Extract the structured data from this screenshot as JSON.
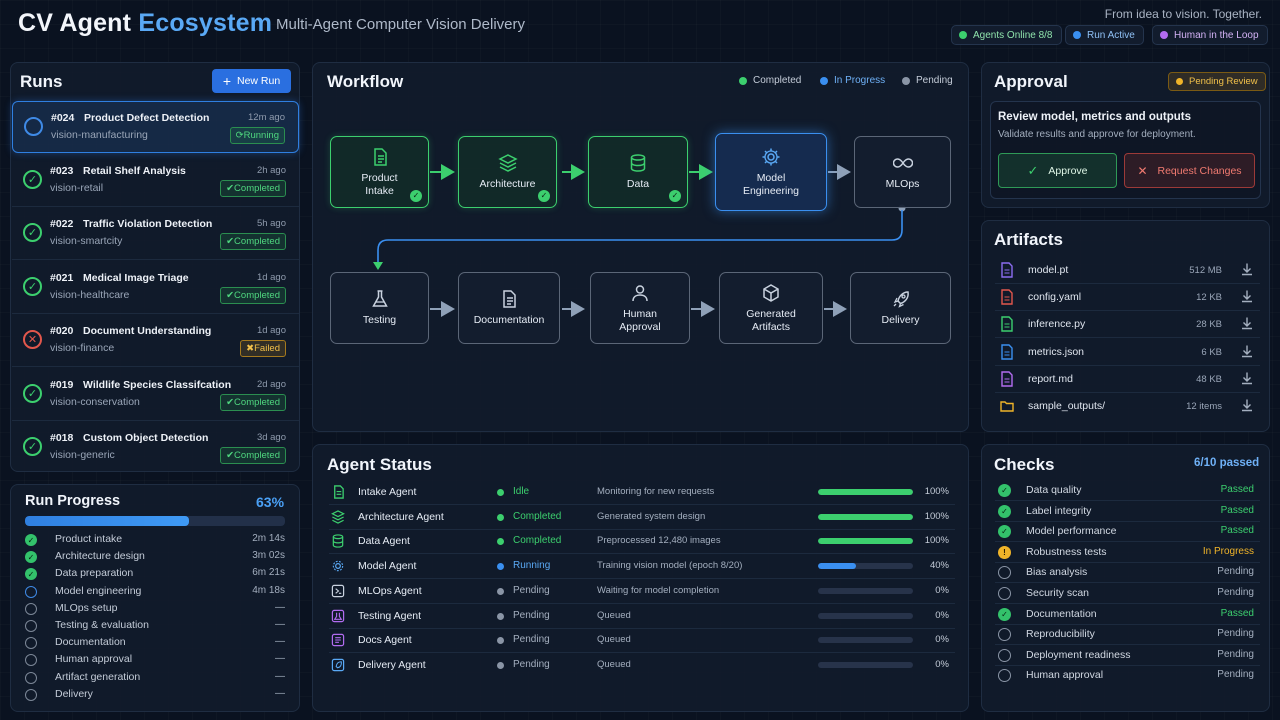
{
  "header": {
    "title_main": "CV Agent",
    "title_accent": "Ecosystem",
    "subtitle": "Multi-Agent Computer Vision Delivery",
    "tagline": "From idea to vision. Together.",
    "badges": [
      {
        "label": "Agents Online 8/8",
        "color": "#3ccf6e"
      },
      {
        "label": "Run Active",
        "color": "#3a8ff0"
      },
      {
        "label": "Human in the Loop",
        "color": "#b26cf0"
      }
    ]
  },
  "runs": {
    "title": "Runs",
    "new_run_label": "New Run",
    "items": [
      {
        "id": "#024",
        "name": "Product Defect Detection",
        "project": "vision-manufacturing",
        "time": "12m ago",
        "status": "Running"
      },
      {
        "id": "#023",
        "name": "Retail Shelf Analysis",
        "project": "vision-retail",
        "time": "2h ago",
        "status": "Completed"
      },
      {
        "id": "#022",
        "name": "Traffic Violation Detection",
        "project": "vision-smartcity",
        "time": "5h ago",
        "status": "Completed"
      },
      {
        "id": "#021",
        "name": "Medical Image Triage",
        "project": "vision-healthcare",
        "time": "1d ago",
        "status": "Completed"
      },
      {
        "id": "#020",
        "name": "Document Understanding",
        "project": "vision-finance",
        "time": "1d ago",
        "status": "Failed"
      },
      {
        "id": "#019",
        "name": "Wildlife Species Classifcation",
        "project": "vision-conservation",
        "time": "2d ago",
        "status": "Completed"
      },
      {
        "id": "#018",
        "name": "Custom Object Detection",
        "project": "vision-generic",
        "time": "3d ago",
        "status": "Completed"
      }
    ]
  },
  "run_progress": {
    "title": "Run Progress",
    "percent_label": "63%",
    "percent": 63,
    "steps": [
      {
        "label": "Product intake",
        "value": "2m 14s",
        "state": "done"
      },
      {
        "label": "Architecture design",
        "value": "3m 02s",
        "state": "done"
      },
      {
        "label": "Data preparation",
        "value": "6m 21s",
        "state": "done"
      },
      {
        "label": "Model engineering",
        "value": "4m 18s",
        "state": "running"
      },
      {
        "label": "MLOps setup",
        "value": "—",
        "state": "pending"
      },
      {
        "label": "Testing & evaluation",
        "value": "—",
        "state": "pending"
      },
      {
        "label": "Documentation",
        "value": "—",
        "state": "pending"
      },
      {
        "label": "Human approval",
        "value": "—",
        "state": "pending"
      },
      {
        "label": "Artifact generation",
        "value": "—",
        "state": "pending"
      },
      {
        "label": "Delivery",
        "value": "—",
        "state": "pending"
      }
    ]
  },
  "workflow": {
    "title": "Workflow",
    "legend": [
      {
        "label": "Completed",
        "color": "#3ccf6e"
      },
      {
        "label": "In Progress",
        "color": "#3a8ff0"
      },
      {
        "label": "Pending",
        "color": "#8a95a6"
      }
    ],
    "nodes": [
      {
        "label": "Product Intake",
        "state": "done",
        "icon": "document-icon"
      },
      {
        "label": "Architecture",
        "state": "done",
        "icon": "layers-icon"
      },
      {
        "label": "Data",
        "state": "done",
        "icon": "database-icon"
      },
      {
        "label": "Model Engineering",
        "state": "progress",
        "icon": "gear-icon"
      },
      {
        "label": "MLOps",
        "state": "pending",
        "icon": "infinity-icon"
      },
      {
        "label": "Testing",
        "state": "pending",
        "icon": "flask-icon"
      },
      {
        "label": "Documentation",
        "state": "pending",
        "icon": "document-icon"
      },
      {
        "label": "Human Approval",
        "state": "pending",
        "icon": "user-icon"
      },
      {
        "label": "Generated Artifacts",
        "state": "pending",
        "icon": "cube-icon"
      },
      {
        "label": "Delivery",
        "state": "pending",
        "icon": "rocket-icon"
      }
    ]
  },
  "agent_status": {
    "title": "Agent Status",
    "agents": [
      {
        "name": "Intake Agent",
        "status": "Idle",
        "desc": "Monitoring for new requests",
        "progress": 100,
        "pct": "100%",
        "color": "#3ccf6e"
      },
      {
        "name": "Architecture Agent",
        "status": "Completed",
        "desc": "Generated system design",
        "progress": 100,
        "pct": "100%",
        "color": "#3ccf6e"
      },
      {
        "name": "Data Agent",
        "status": "Completed",
        "desc": "Preprocessed 12,480 images",
        "progress": 100,
        "pct": "100%",
        "color": "#3ccf6e"
      },
      {
        "name": "Model Agent",
        "status": "Running",
        "desc": "Training vision model (epoch 8/20)",
        "progress": 40,
        "pct": "40%",
        "color": "#3a8ff0"
      },
      {
        "name": "MLOps Agent",
        "status": "Pending",
        "desc": "Waiting for model completion",
        "progress": 0,
        "pct": "0%",
        "color": "#8a95a6"
      },
      {
        "name": "Testing Agent",
        "status": "Pending",
        "desc": "Queued",
        "progress": 0,
        "pct": "0%",
        "color": "#8a95a6"
      },
      {
        "name": "Docs Agent",
        "status": "Pending",
        "desc": "Queued",
        "progress": 0,
        "pct": "0%",
        "color": "#8a95a6"
      },
      {
        "name": "Delivery Agent",
        "status": "Pending",
        "desc": "Queued",
        "progress": 0,
        "pct": "0%",
        "color": "#8a95a6"
      }
    ]
  },
  "approval": {
    "title": "Approval",
    "badge": "Pending Review",
    "heading": "Review model, metrics and outputs",
    "description": "Validate results and approve for deployment.",
    "approve_label": "Approve",
    "request_changes_label": "Request Changes"
  },
  "artifacts": {
    "title": "Artifacts",
    "files": [
      {
        "name": "model.pt",
        "size": "512 MB",
        "color": "#8b6cf0"
      },
      {
        "name": "config.yaml",
        "size": "12 KB",
        "color": "#e2574c"
      },
      {
        "name": "inference.py",
        "size": "28 KB",
        "color": "#3ccf6e"
      },
      {
        "name": "metrics.json",
        "size": "6 KB",
        "color": "#3a8ff0"
      },
      {
        "name": "report.md",
        "size": "48 KB",
        "color": "#b26cf0"
      },
      {
        "name": "sample_outputs/",
        "size": "12 items",
        "color": "#f0b429"
      }
    ]
  },
  "checks": {
    "title": "Checks",
    "summary": "6/10 passed",
    "items": [
      {
        "label": "Data quality",
        "status": "Passed",
        "state": "pass"
      },
      {
        "label": "Label integrity",
        "status": "Passed",
        "state": "pass"
      },
      {
        "label": "Model performance",
        "status": "Passed",
        "state": "pass"
      },
      {
        "label": "Robustness tests",
        "status": "In Progress",
        "state": "warn"
      },
      {
        "label": "Bias analysis",
        "status": "Pending",
        "state": "pend"
      },
      {
        "label": "Security scan",
        "status": "Pending",
        "state": "pend"
      },
      {
        "label": "Documentation",
        "status": "Passed",
        "state": "pass"
      },
      {
        "label": "Reproducibility",
        "status": "Pending",
        "state": "pend"
      },
      {
        "label": "Deployment readiness",
        "status": "Pending",
        "state": "pend"
      },
      {
        "label": "Human approval",
        "status": "Pending",
        "state": "pend"
      }
    ]
  }
}
